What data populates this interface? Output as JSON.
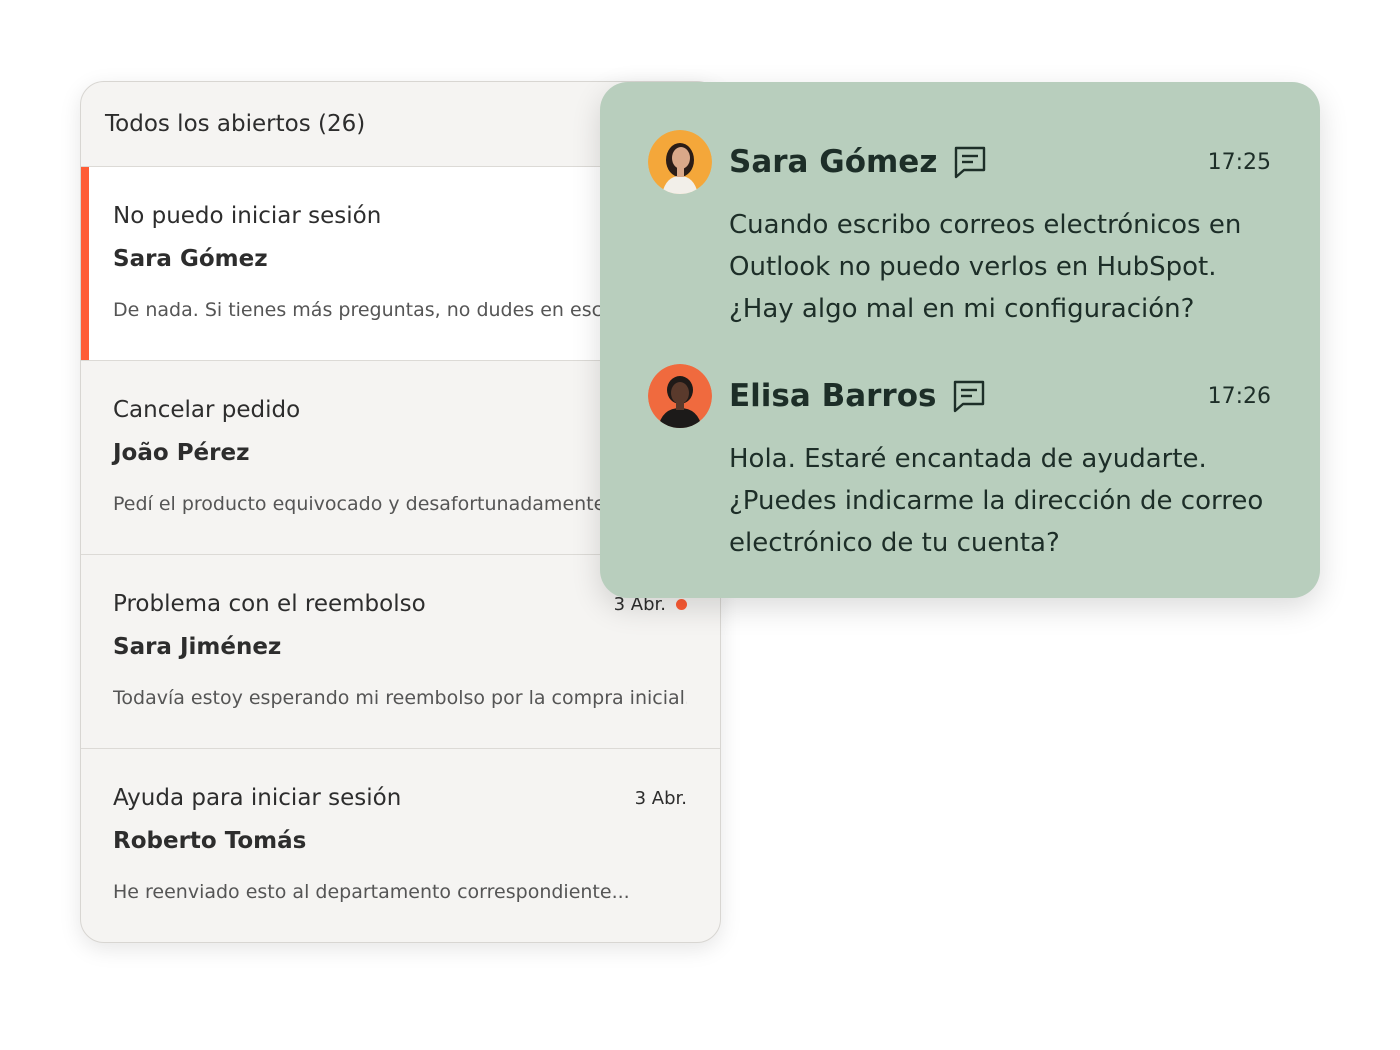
{
  "inbox": {
    "title": "Todos los abiertos (26)",
    "rows": [
      {
        "subject": "No puedo iniciar sesión",
        "date": "",
        "sender": "Sara Gómez",
        "preview": "De nada. Si tienes más preguntas, no dudes en escribirnos..."
      },
      {
        "subject": "Cancelar pedido",
        "date": "",
        "sender": "João Pérez",
        "preview": "Pedí el producto equivocado y desafortunadamente..."
      },
      {
        "subject": "Problema con el reembolso",
        "date": "3 Abr.",
        "sender": "Sara Jiménez",
        "preview": "Todavía estoy esperando mi reembolso por la compra inicial..."
      },
      {
        "subject": "Ayuda para iniciar sesión",
        "date": "3 Abr.",
        "sender": "Roberto Tomás",
        "preview": "He reenviado esto al departamento correspondiente..."
      }
    ]
  },
  "chat": {
    "messages": [
      {
        "name": "Sara Gómez",
        "time": "17:25",
        "lines": [
          "Cuando escribo correos electrónicos en",
          "Outlook no puedo verlos en HubSpot.",
          "¿Hay algo mal en mi configuración?"
        ]
      },
      {
        "name": "Elisa Barros",
        "time": "17:26",
        "lines": [
          "Hola. Estaré encantada de ayudarte.",
          "¿Puedes indicarme la dirección de correo",
          "electrónico de tu cuenta?"
        ]
      }
    ]
  },
  "colors": {
    "accent": "#ff5c35",
    "chat_bg": "#b8cebd",
    "list_bg": "#f5f4f2",
    "text_dark": "#1d2e28"
  },
  "icons": [
    "chat-bubble-icon",
    "unread-dot-icon",
    "avatar"
  ]
}
